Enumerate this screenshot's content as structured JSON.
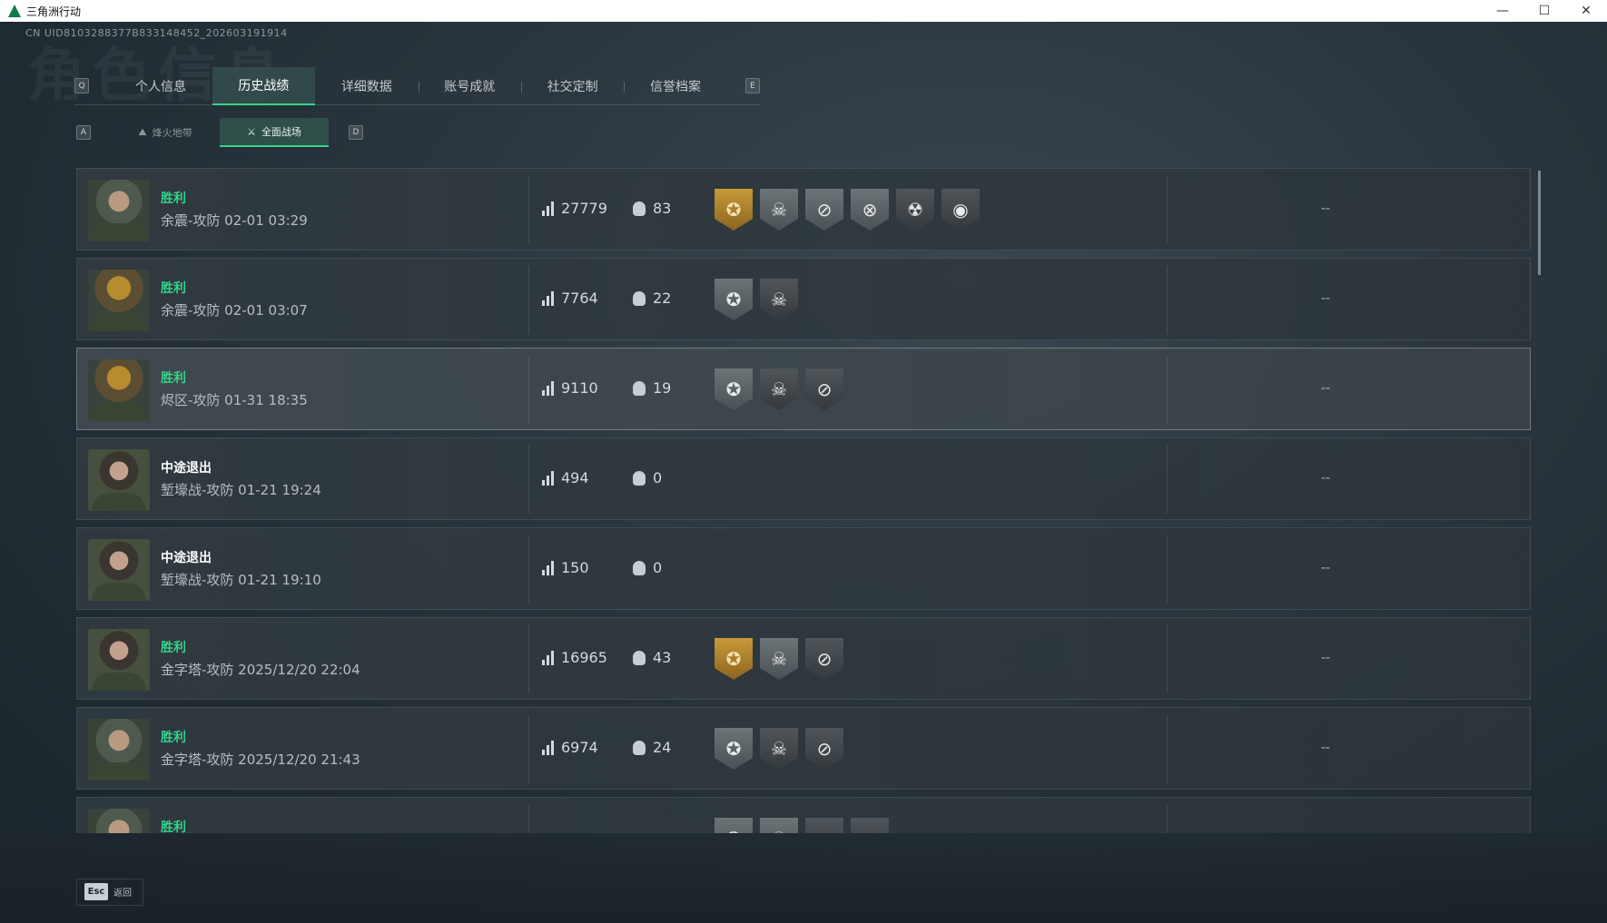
{
  "window": {
    "title": "三角洲行动",
    "minimize": "—",
    "maximize": "☐",
    "close": "✕"
  },
  "watermark": "角色信息",
  "uid": "CN UID8103288377B833148452_202603191914",
  "tabs": {
    "left_key": "Q",
    "right_key": "E",
    "items": [
      {
        "label": "个人信息",
        "active": false
      },
      {
        "label": "历史战绩",
        "active": true
      },
      {
        "label": "详细数据",
        "active": false
      },
      {
        "label": "账号成就",
        "active": false
      },
      {
        "label": "社交定制",
        "active": false
      },
      {
        "label": "信誉档案",
        "active": false
      }
    ]
  },
  "subtabs": {
    "left_key": "A",
    "right_key": "D",
    "items": [
      {
        "label": "烽火地带",
        "icon": "zone-icon",
        "active": false
      },
      {
        "label": "全面战场",
        "icon": "battlefield-icon",
        "active": true
      }
    ]
  },
  "matches": [
    {
      "result": "胜利",
      "map": "余震-攻防 02-01 03:29",
      "score": "27779",
      "kills": "83",
      "avatar": "male",
      "badges": [
        "gold",
        "grey",
        "grey",
        "grey",
        "dark",
        "dark"
      ],
      "extra": "--"
    },
    {
      "result": "胜利",
      "map": "余震-攻防 02-01 03:07",
      "score": "7764",
      "kills": "22",
      "avatar": "helm",
      "badges": [
        "grey",
        "dark"
      ],
      "extra": "--"
    },
    {
      "result": "胜利",
      "map": "烬区-攻防 01-31 18:35",
      "score": "9110",
      "kills": "19",
      "avatar": "helm",
      "badges": [
        "grey",
        "dark",
        "dark"
      ],
      "extra": "--"
    },
    {
      "result": "中途退出",
      "map": "堑壕战-攻防 01-21 19:24",
      "score": "494",
      "kills": "0",
      "avatar": "female",
      "badges": [],
      "extra": "--"
    },
    {
      "result": "中途退出",
      "map": "堑壕战-攻防 01-21 19:10",
      "score": "150",
      "kills": "0",
      "avatar": "female",
      "badges": [],
      "extra": "--"
    },
    {
      "result": "胜利",
      "map": "金字塔-攻防 2025/12/20 22:04",
      "score": "16965",
      "kills": "43",
      "avatar": "female",
      "badges": [
        "gold",
        "grey",
        "dark"
      ],
      "extra": "--"
    },
    {
      "result": "胜利",
      "map": "金字塔-攻防 2025/12/20 21:43",
      "score": "6974",
      "kills": "24",
      "avatar": "male",
      "badges": [
        "grey",
        "dark",
        "dark"
      ],
      "extra": "--"
    },
    {
      "result": "胜利",
      "map": "",
      "score": "",
      "kills": "",
      "avatar": "male",
      "badges": [
        "grey",
        "grey",
        "dark",
        "dark"
      ],
      "extra": ""
    }
  ],
  "footer": {
    "esc_key": "Esc",
    "back_label": "返回"
  }
}
